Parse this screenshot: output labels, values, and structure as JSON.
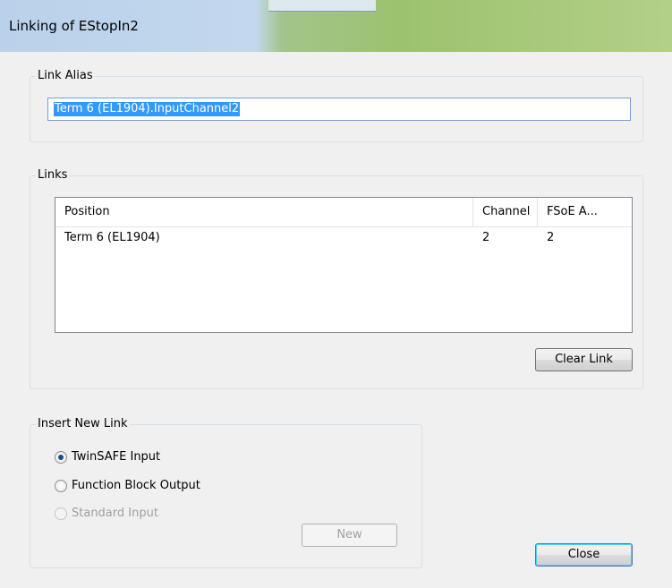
{
  "window": {
    "title": "Linking of EStopIn2"
  },
  "link_alias": {
    "legend": "Link Alias",
    "value": "Term 6 (EL1904).InputChannel2"
  },
  "links": {
    "legend": "Links",
    "columns": [
      "Position",
      "Channel",
      "FSoE A..."
    ],
    "rows": [
      {
        "position": "Term 6 (EL1904)",
        "channel": "2",
        "fsoe": "2"
      }
    ],
    "clear_button": "Clear Link"
  },
  "insert": {
    "legend": "Insert New Link",
    "options": [
      {
        "label": "TwinSAFE Input",
        "selected": true,
        "enabled": true
      },
      {
        "label": "Function Block Output",
        "selected": false,
        "enabled": true
      },
      {
        "label": "Standard Input",
        "selected": false,
        "enabled": false
      }
    ],
    "new_button": "New"
  },
  "close_button": "Close"
}
